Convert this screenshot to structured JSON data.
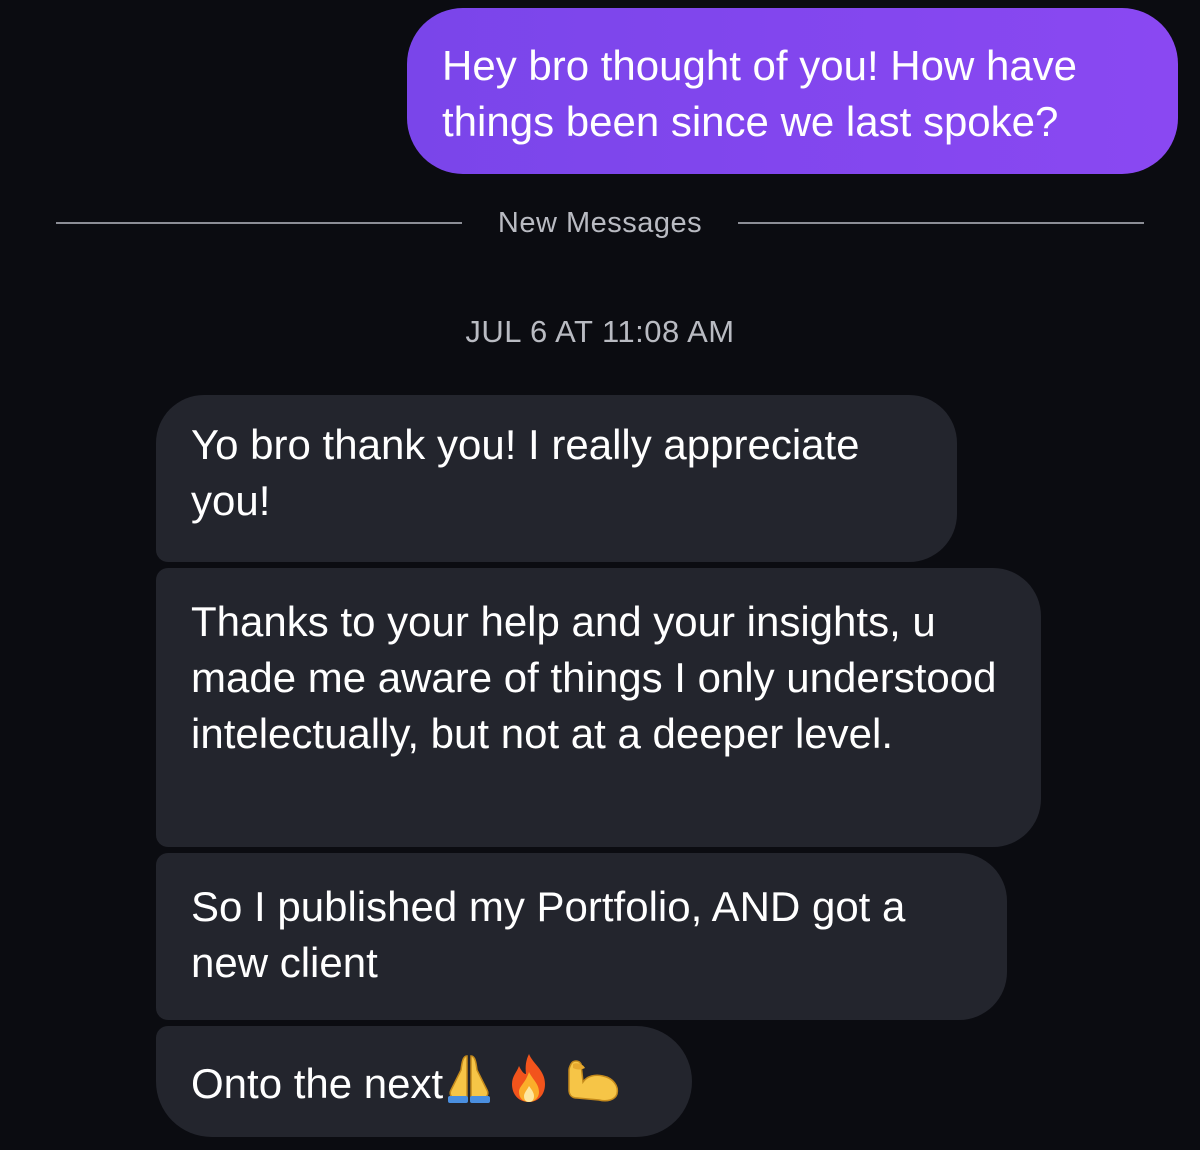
{
  "conversation": {
    "sent_message": "Hey bro thought of you! How have things been since we last spoke?",
    "divider_label": "New Messages",
    "timestamp": "JUL 6 AT 11:08 AM",
    "received_messages": [
      {
        "text": "Yo bro thank you! I really appreciate you!"
      },
      {
        "text": "Thanks to your help and your insights, u made me aware of things I only understood intelectually, but not at a deeper level."
      },
      {
        "text": "So I published my Portfolio, AND got a new client"
      },
      {
        "text": "Onto the next",
        "emojis": [
          "folded-hands-icon",
          "fire-icon",
          "flexed-biceps-icon"
        ]
      }
    ]
  },
  "colors": {
    "background": "#0b0c11",
    "sent_bubble": "#7f46ee",
    "received_bubble": "#23252d",
    "meta_text": "#b9bbc2"
  }
}
